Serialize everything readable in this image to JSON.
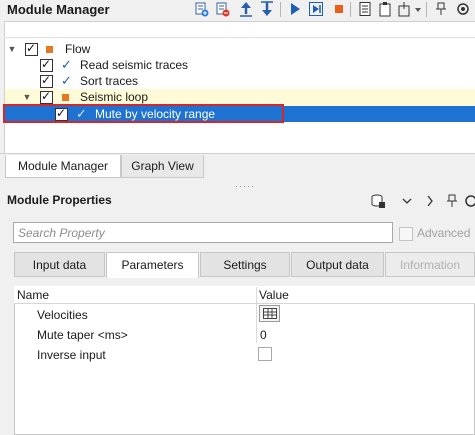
{
  "module_manager": {
    "title": "Module Manager",
    "toolbar_icons": [
      "add-module-icon",
      "remove-module-icon",
      "move-up-icon",
      "move-down-icon",
      "run-icon",
      "run-to-selected-icon",
      "stop-icon",
      "log-icon",
      "clipboard-icon",
      "menu-dropdown-icon",
      "pin-icon",
      "settings-icon"
    ]
  },
  "tree": {
    "root": {
      "label": "Flow",
      "checked": true
    },
    "items": [
      {
        "label": "Read seismic traces",
        "checked": true
      },
      {
        "label": "Sort traces",
        "checked": true
      }
    ],
    "loop": {
      "label": "Seismic loop",
      "checked": true
    },
    "selected": {
      "label": "Mute by velocity range",
      "checked": true
    }
  },
  "bottom_tabs": [
    "Module Manager",
    "Graph View"
  ],
  "module_properties": {
    "title": "Module Properties",
    "search_placeholder": "Search Property",
    "advanced_label": "Advanced",
    "tabs": [
      "Input data",
      "Parameters",
      "Settings",
      "Output data",
      "Information"
    ],
    "active_tab": "Parameters"
  },
  "grid": {
    "headers": {
      "name": "Name",
      "value": "Value"
    },
    "rows": [
      {
        "name": "Velocities",
        "value": ""
      },
      {
        "name": "Mute taper <ms>",
        "value": "0"
      },
      {
        "name": "Inverse input",
        "value": ""
      }
    ]
  },
  "colors": {
    "selection": "#1e73d2",
    "highlight_box": "#d7262b",
    "loop_bg": "#fffbd9",
    "orange_square": "#e87722",
    "blue_check": "#1f5fb3"
  }
}
